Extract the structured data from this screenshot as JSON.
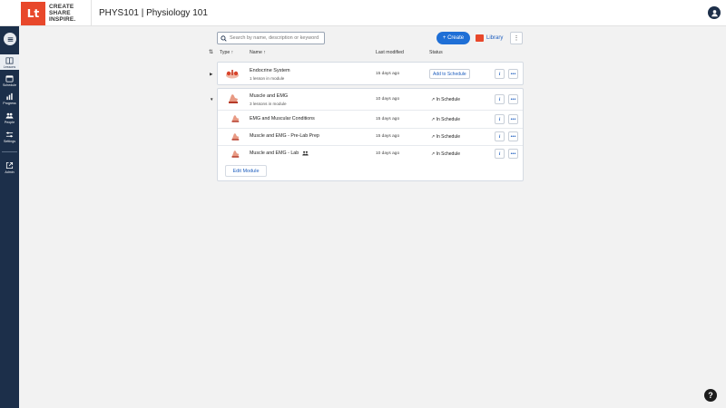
{
  "header": {
    "logo_mark": "Lt",
    "logo_line1": "CREATE",
    "logo_line2": "SHARE",
    "logo_line3": "INSPIRE.",
    "course_title": "PHYS101 | Physiology 101"
  },
  "sidebar": {
    "items": [
      {
        "label": "Lessons",
        "icon": "book-icon"
      },
      {
        "label": "Schedule",
        "icon": "calendar-icon"
      },
      {
        "label": "Progress",
        "icon": "bar-chart-icon"
      },
      {
        "label": "People",
        "icon": "people-icon"
      },
      {
        "label": "Settings",
        "icon": "sliders-icon"
      },
      {
        "label": "Admin",
        "icon": "external-link-icon"
      }
    ]
  },
  "toolbar": {
    "search_placeholder": "Search by name, description or keyword",
    "create_label": "+ Create",
    "library_label": "Library",
    "more_label": "⋮"
  },
  "columns": {
    "type": "Type ↑",
    "name": "Name ↑",
    "last_modified": "Last modified",
    "status": "Status"
  },
  "modules": [
    {
      "name": "Endocrine System",
      "subtitle": "1 lesson in module",
      "last_modified": "15 days ago",
      "status_action": "Add to Schedule",
      "expanded": false
    },
    {
      "name": "Muscle and EMG",
      "subtitle": "3 lessons in module",
      "last_modified": "10 days ago",
      "status": "↗ In Schedule",
      "expanded": true,
      "lessons": [
        {
          "name": "EMG and Muscular Conditions",
          "last_modified": "15 days ago",
          "status": "↗ In Schedule"
        },
        {
          "name": "Muscle and EMG - Pre-Lab Prep",
          "last_modified": "15 days ago",
          "status": "↗ In Schedule"
        },
        {
          "name": "Muscle and EMG - Lab",
          "last_modified": "10 days ago",
          "status": "↗ In Schedule"
        }
      ],
      "edit_label": "Edit Module"
    }
  ],
  "icons": {
    "info": "i",
    "more": "•••",
    "help": "?",
    "expand": "▶",
    "collapse": "▼",
    "sort": "⇅"
  },
  "colors": {
    "brand": "#e8482b",
    "sidebar": "#1c2f4a",
    "accent": "#1f6fd6"
  }
}
